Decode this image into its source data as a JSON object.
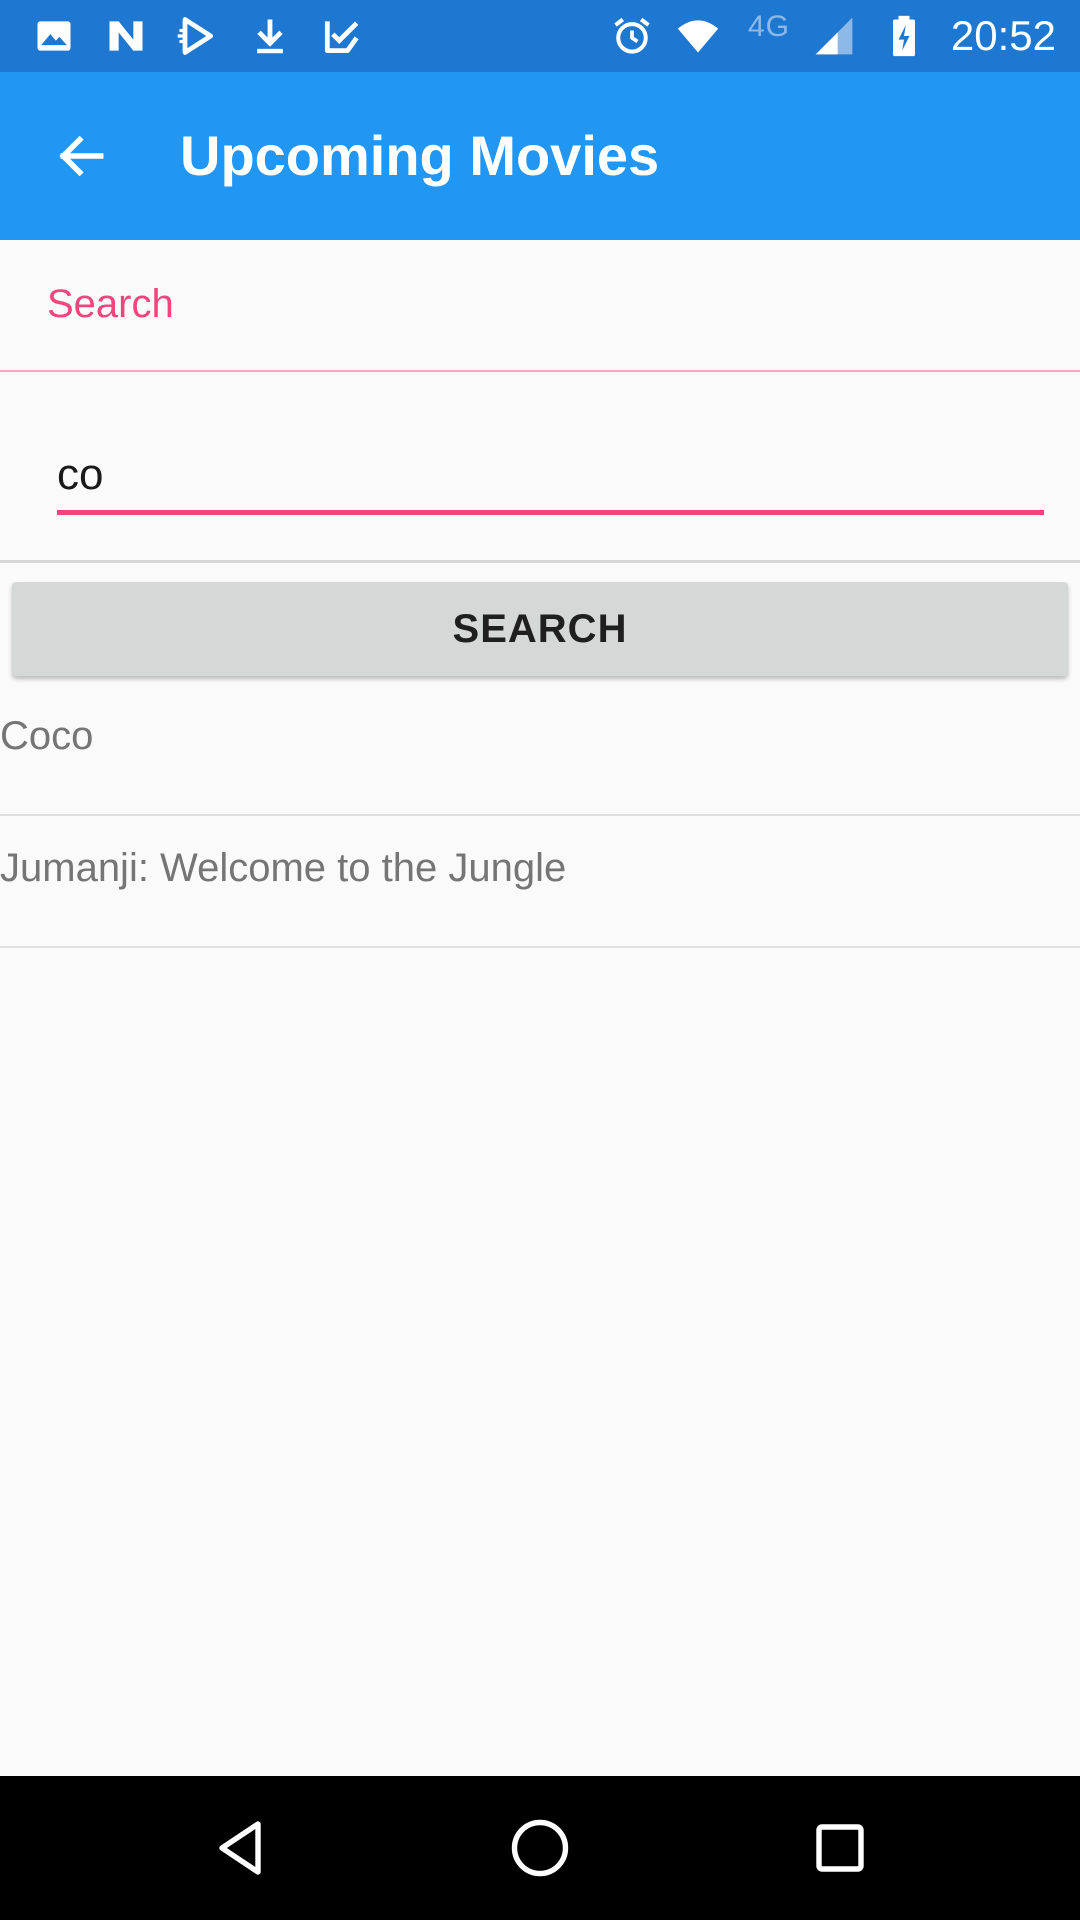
{
  "status_bar": {
    "time": "20:52",
    "network_label": "4G",
    "icons": [
      "gallery-icon",
      "n-logo-icon",
      "play-store-icon",
      "download-icon",
      "clipboard-check-icon",
      "alarm-icon",
      "wifi-icon",
      "signal-icon",
      "battery-charging-icon"
    ]
  },
  "app_bar": {
    "title": "Upcoming Movies",
    "back_icon": "arrow-left-icon"
  },
  "search": {
    "label": "Search",
    "value": "co",
    "button_label": "SEARCH"
  },
  "results": [
    {
      "title": "Coco"
    },
    {
      "title": "Jumanji: Welcome to the Jungle"
    }
  ],
  "nav_bar": {
    "icons": [
      "back-triangle-icon",
      "home-circle-icon",
      "recents-square-icon"
    ]
  },
  "colors": {
    "status_bar": "#1E78D2",
    "app_bar": "#2196F3",
    "accent": "#F0457D",
    "background": "#FAFAFA",
    "button": "#D6D7D7"
  }
}
